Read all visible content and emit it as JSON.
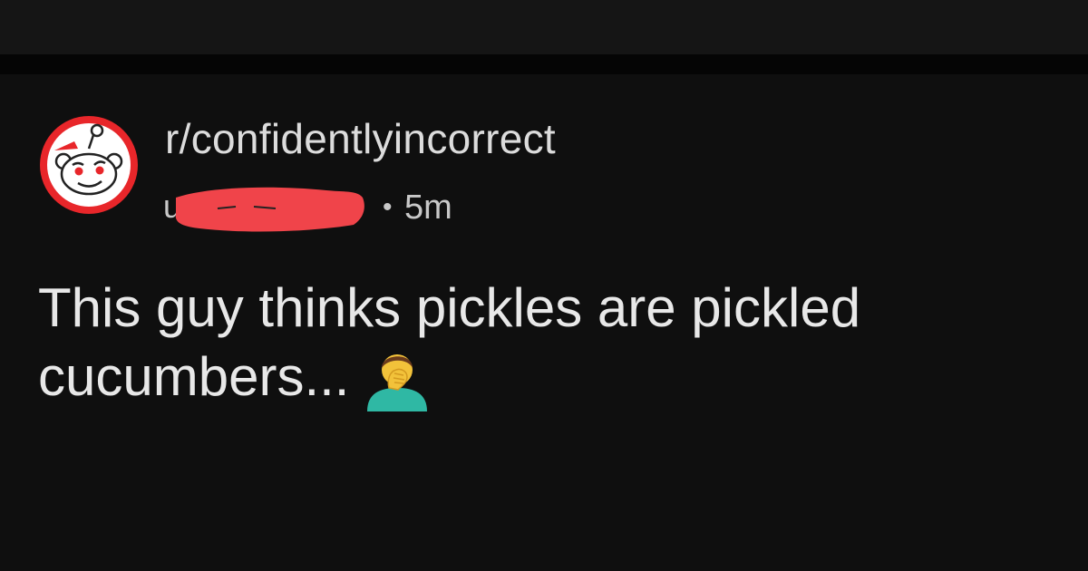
{
  "post": {
    "subreddit": "r/confidentlyincorrect",
    "username_visible": "u",
    "meta_separator": "•",
    "age": "5m",
    "title_text": "This guy thinks pickles are pickled cucumbers...",
    "title_emoji": "man-facepalming"
  },
  "icons": {
    "avatar": "reddit-snoo-avatar-icon",
    "emoji": "man-facepalming-icon"
  },
  "colors": {
    "background": "#0f0f0f",
    "avatar_ring": "#e8262a",
    "redaction": "#f0444a",
    "text": "#e8e8e8"
  }
}
